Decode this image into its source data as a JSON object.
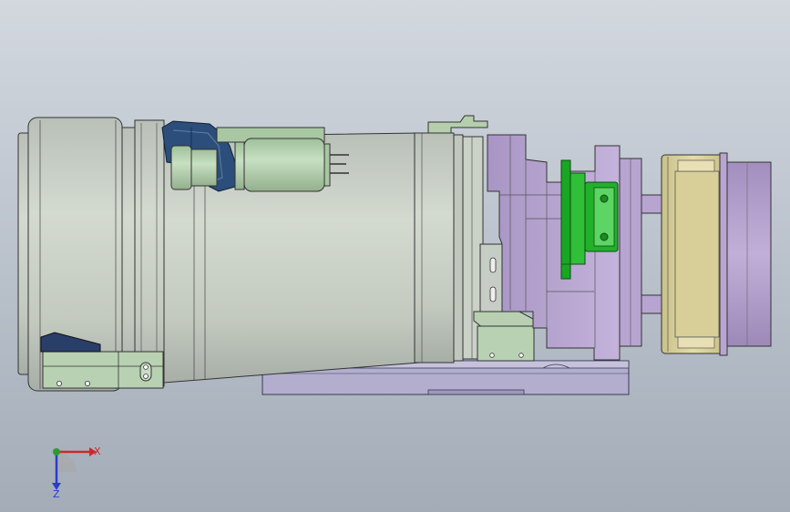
{
  "viewport": {
    "background_top": "#d3d8df",
    "background_bottom": "#a3acb7"
  },
  "triad": {
    "x_label": "X",
    "z_label": "Z",
    "x_color": "#cc2a2a",
    "z_color": "#2a3ccc",
    "y_color": "#2f9a2f"
  },
  "parts": {
    "lens_body_color": "#c5ccc2",
    "motor_color": "#b5d2b0",
    "bracket_color": "#b9a6d1",
    "flange_color": "#ddd6a3",
    "base_plate_color": "#b6b1d0",
    "green_clamp_color": "#19a822",
    "dark_cap_color": "#2b4e7a"
  }
}
